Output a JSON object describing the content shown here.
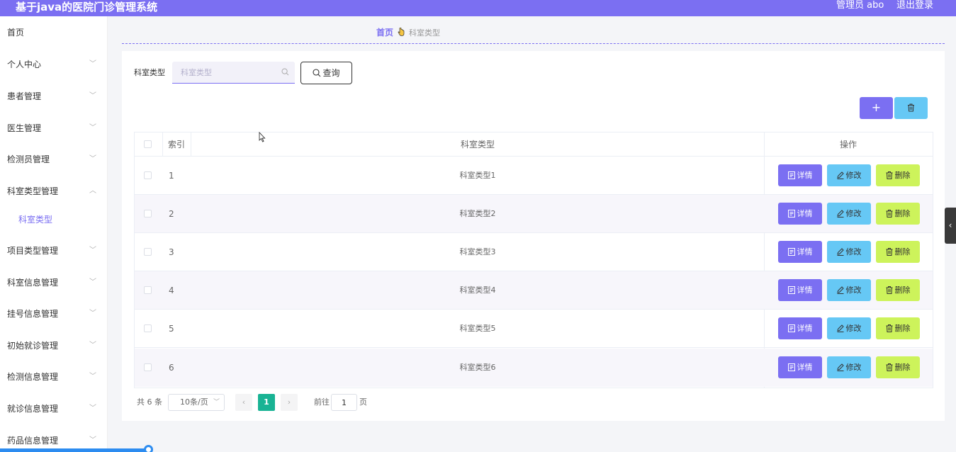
{
  "header": {
    "title": "基于java的医院门诊管理系统",
    "admin_label": "管理员 abo",
    "logout_label": "退出登录"
  },
  "sidebar": {
    "items": [
      {
        "label": "首页",
        "has_arrow": false
      },
      {
        "label": "个人中心",
        "has_arrow": true
      },
      {
        "label": "患者管理",
        "has_arrow": true
      },
      {
        "label": "医生管理",
        "has_arrow": true
      },
      {
        "label": "检测员管理",
        "has_arrow": true
      },
      {
        "label": "科室类型管理",
        "has_arrow": true,
        "expanded": true
      },
      {
        "label": "项目类型管理",
        "has_arrow": true
      },
      {
        "label": "科室信息管理",
        "has_arrow": true
      },
      {
        "label": "挂号信息管理",
        "has_arrow": true
      },
      {
        "label": "初始就诊管理",
        "has_arrow": true
      },
      {
        "label": "检测信息管理",
        "has_arrow": true
      },
      {
        "label": "就诊信息管理",
        "has_arrow": true
      },
      {
        "label": "药品信息管理",
        "has_arrow": true
      }
    ],
    "sub_item": "科室类型"
  },
  "breadcrumb": {
    "home": "首页",
    "current": "科室类型"
  },
  "search": {
    "label": "科室类型",
    "placeholder": "科室类型",
    "button_label": "查询"
  },
  "toolbar": {
    "add_symbol": "+"
  },
  "table": {
    "headers": {
      "index": "索引",
      "type": "科室类型",
      "actions": "操作"
    },
    "rows": [
      {
        "index": "1",
        "type": "科室类型1"
      },
      {
        "index": "2",
        "type": "科室类型2"
      },
      {
        "index": "3",
        "type": "科室类型3"
      },
      {
        "index": "4",
        "type": "科室类型4"
      },
      {
        "index": "5",
        "type": "科室类型5"
      },
      {
        "index": "6",
        "type": "科室类型6"
      }
    ],
    "actions": {
      "detail": "详情",
      "edit": "修改",
      "delete": "删除"
    }
  },
  "pagination": {
    "total_text": "共 6 条",
    "page_size": "10条/页",
    "current_page": "1",
    "goto_label": "前往",
    "goto_value": "1",
    "page_unit": "页"
  },
  "colors": {
    "primary": "#7b6ff2",
    "info": "#66c8f5",
    "warning": "#cdf35b",
    "active_page": "#19b394"
  }
}
